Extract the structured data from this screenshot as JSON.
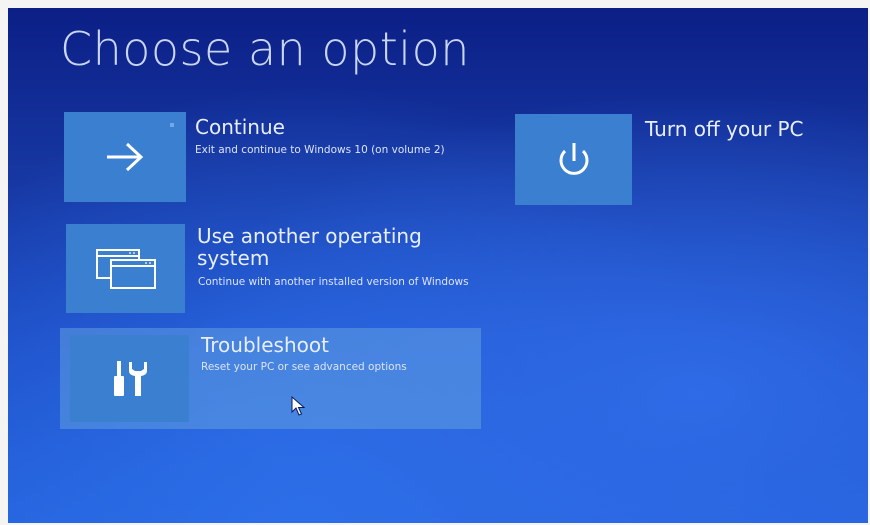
{
  "title": "Choose an option",
  "options": [
    {
      "id": "continue",
      "icon": "arrow-right-icon",
      "label": "Continue",
      "description": "Exit and continue to Windows 10 (on volume 2)"
    },
    {
      "id": "other-os",
      "icon": "windows-stack-icon",
      "label": "Use another operating system",
      "description": "Continue with another installed version of Windows"
    },
    {
      "id": "troubleshoot",
      "icon": "tools-icon",
      "label": "Troubleshoot",
      "description": "Reset your PC or see advanced options",
      "highlighted": true
    },
    {
      "id": "turn-off",
      "icon": "power-icon",
      "label": "Turn off your PC"
    }
  ],
  "colors": {
    "background_top": "#0b1f86",
    "background_bottom": "#2462dc",
    "tile": "#3b7fd0",
    "highlight": "#609ee2",
    "text": "#ffffff"
  }
}
